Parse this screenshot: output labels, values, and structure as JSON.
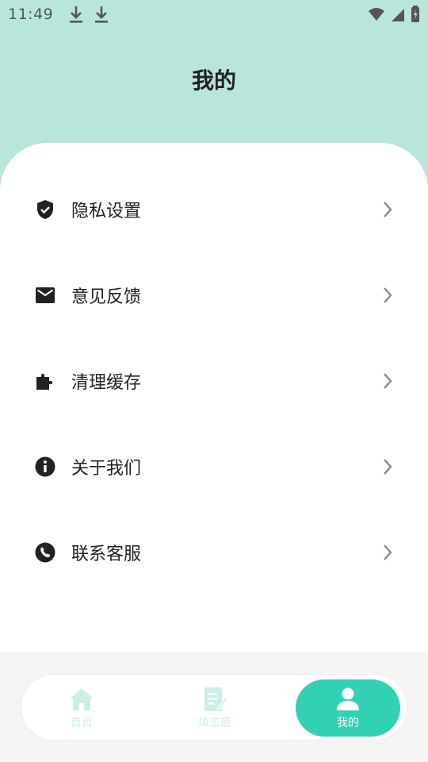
{
  "status_bar": {
    "time": "11:49"
  },
  "header": {
    "title": "我的"
  },
  "menu": {
    "items": [
      {
        "label": "隐私设置",
        "icon": "shield-check-icon"
      },
      {
        "label": "意见反馈",
        "icon": "mail-icon"
      },
      {
        "label": "清理缓存",
        "icon": "puzzle-icon"
      },
      {
        "label": "关于我们",
        "icon": "info-icon"
      },
      {
        "label": "联系客服",
        "icon": "phone-icon"
      }
    ]
  },
  "tabbar": {
    "tabs": [
      {
        "label": "首页",
        "icon": "home-icon",
        "active": false
      },
      {
        "label": "填志愿",
        "icon": "edit-form-icon",
        "active": false
      },
      {
        "label": "我的",
        "icon": "user-icon",
        "active": true
      }
    ]
  },
  "colors": {
    "header_bg": "#b8e6dc",
    "accent": "#33d1b3",
    "inactive_tab": "#cdeee7",
    "text": "#222222"
  }
}
